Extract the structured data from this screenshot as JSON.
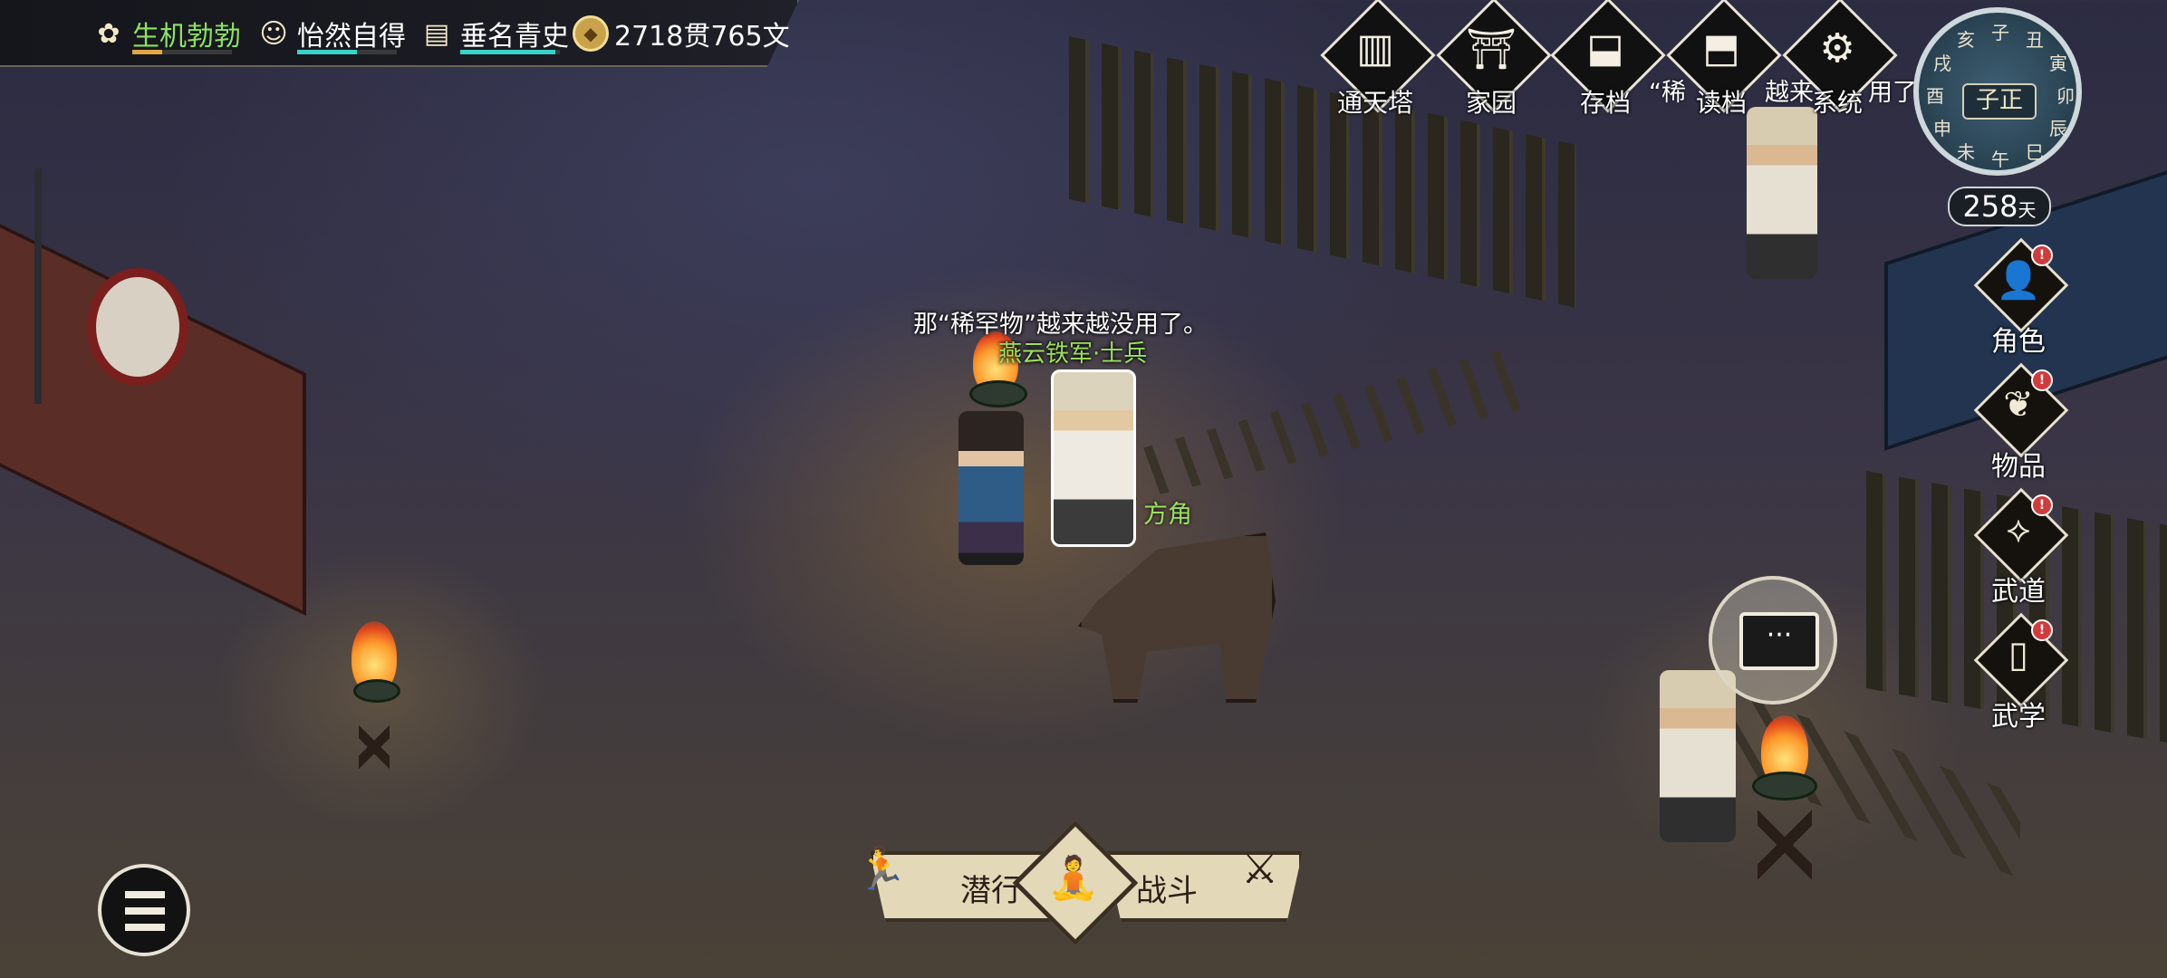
{
  "status_bar": {
    "vitality": {
      "label": "生机勃勃",
      "progress": 0.3,
      "color": "#8be35f"
    },
    "mood": {
      "label": "怡然自得",
      "progress": 0.6,
      "color": "#3ad1c8"
    },
    "fame": {
      "label": "垂名青史",
      "progress": 0.95,
      "color": "#3ad1c8"
    },
    "money": {
      "label": "2718贯765文",
      "icon": "coin-icon"
    }
  },
  "top_menu": [
    {
      "label": "通天塔",
      "icon": "tower-icon"
    },
    {
      "label": "家园",
      "icon": "home-icon"
    },
    {
      "label": "存档",
      "icon": "save-icon"
    },
    {
      "label": "读档",
      "icon": "load-icon"
    },
    {
      "label": "系统",
      "icon": "gear-icon"
    }
  ],
  "clock": {
    "time_label": "子正",
    "branches": [
      "子",
      "丑",
      "寅",
      "卯",
      "辰",
      "巳",
      "午",
      "未",
      "申",
      "酉",
      "戌",
      "亥"
    ],
    "days": "258",
    "days_unit": "天"
  },
  "side_menu": [
    {
      "label": "角色",
      "icon": "character-icon",
      "alert": "!"
    },
    {
      "label": "物品",
      "icon": "bag-icon",
      "alert": "!"
    },
    {
      "label": "武道",
      "icon": "martial-path-icon",
      "alert": "!"
    },
    {
      "label": "武学",
      "icon": "book-icon",
      "alert": "!"
    }
  ],
  "scene": {
    "dialogue": "那“稀罕物”越来越没用了。",
    "npc_name": "燕云铁军·士兵",
    "pet_name": "方角",
    "overflow_fragments": [
      "“稀",
      "越来",
      "用了"
    ]
  },
  "actions": {
    "sneak_label": "潜行",
    "fight_label": "战斗",
    "meditate_icon": "meditate-icon"
  },
  "chat": {
    "label": "···"
  }
}
